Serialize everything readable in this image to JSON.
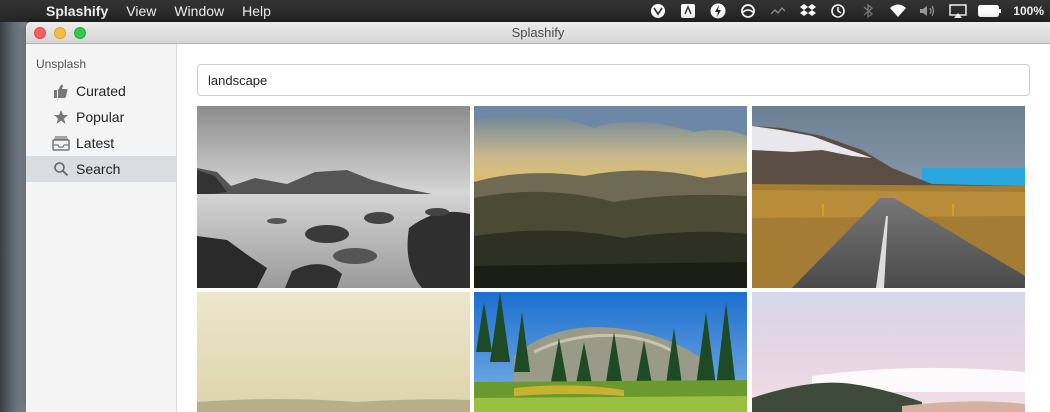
{
  "menubar": {
    "app_name": "Splashify",
    "menus": [
      "View",
      "Window",
      "Help"
    ],
    "battery_percent": "100%"
  },
  "window": {
    "title": "Splashify"
  },
  "sidebar": {
    "section": "Unsplash",
    "items": [
      {
        "label": "Curated",
        "icon": "thumbs-up-icon"
      },
      {
        "label": "Popular",
        "icon": "star-icon"
      },
      {
        "label": "Latest",
        "icon": "inbox-icon"
      },
      {
        "label": "Search",
        "icon": "search-icon",
        "selected": true
      }
    ]
  },
  "search": {
    "value": "landscape"
  },
  "photos": [
    {
      "name": "black-and-white coast with rocks"
    },
    {
      "name": "sunset over hills and valley"
    },
    {
      "name": "road through mountains"
    },
    {
      "name": "misty hazy field"
    },
    {
      "name": "pine forest with granite dome"
    },
    {
      "name": "mountain above clouds"
    }
  ],
  "colors": {
    "selection": "#dadcdf",
    "sidebar": "#f4f4f4"
  }
}
